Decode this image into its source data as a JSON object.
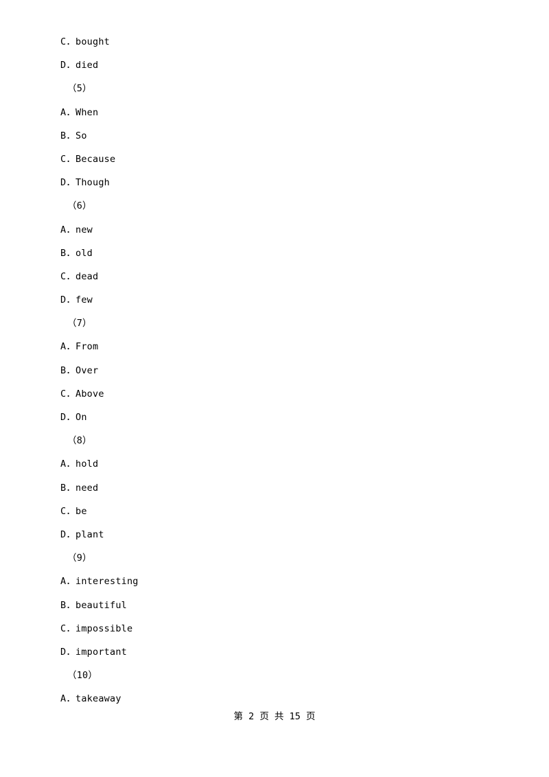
{
  "document": {
    "lines": [
      {
        "text": "C．bought",
        "type": "option"
      },
      {
        "text": "D．died",
        "type": "option"
      },
      {
        "text": "（5）",
        "type": "question"
      },
      {
        "text": "A．When",
        "type": "option"
      },
      {
        "text": "B．So",
        "type": "option"
      },
      {
        "text": "C．Because",
        "type": "option"
      },
      {
        "text": "D．Though",
        "type": "option"
      },
      {
        "text": "（6）",
        "type": "question"
      },
      {
        "text": "A．new",
        "type": "option"
      },
      {
        "text": "B．old",
        "type": "option"
      },
      {
        "text": "C．dead",
        "type": "option"
      },
      {
        "text": "D．few",
        "type": "option"
      },
      {
        "text": "（7）",
        "type": "question"
      },
      {
        "text": "A．From",
        "type": "option"
      },
      {
        "text": "B．Over",
        "type": "option"
      },
      {
        "text": "C．Above",
        "type": "option"
      },
      {
        "text": "D．On",
        "type": "option"
      },
      {
        "text": "（8）",
        "type": "question"
      },
      {
        "text": "A．hold",
        "type": "option"
      },
      {
        "text": "B．need",
        "type": "option"
      },
      {
        "text": "C．be",
        "type": "option"
      },
      {
        "text": "D．plant",
        "type": "option"
      },
      {
        "text": "（9）",
        "type": "question"
      },
      {
        "text": "A．interesting",
        "type": "option"
      },
      {
        "text": "B．beautiful",
        "type": "option"
      },
      {
        "text": "C．impossible",
        "type": "option"
      },
      {
        "text": "D．important",
        "type": "option"
      },
      {
        "text": "（10）",
        "type": "question"
      },
      {
        "text": "A．takeaway",
        "type": "option"
      }
    ],
    "footer": "第 2 页 共 15 页"
  }
}
